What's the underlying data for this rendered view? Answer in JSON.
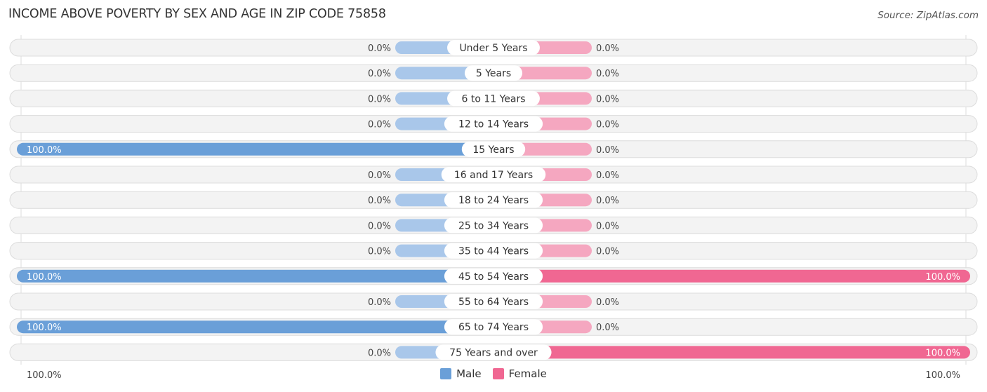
{
  "title": "INCOME ABOVE POVERTY BY SEX AND AGE IN ZIP CODE 75858",
  "source": "Source: ZipAtlas.com",
  "colors": {
    "male": "#6a9fd8",
    "male_light": "#a9c7ea",
    "female": "#f06792",
    "female_light": "#f5a7c0",
    "track": "#f3f3f3"
  },
  "legend": [
    {
      "label": "Male",
      "color": "#6a9fd8"
    },
    {
      "label": "Female",
      "color": "#f06792"
    }
  ],
  "axis": {
    "left_label": "100.0%",
    "right_label": "100.0%"
  },
  "chart_data": {
    "type": "bar",
    "orientation": "horizontal-butterfly",
    "title": "INCOME ABOVE POVERTY BY SEX AND AGE IN ZIP CODE 75858",
    "categories": [
      "Under 5 Years",
      "5 Years",
      "6 to 11 Years",
      "12 to 14 Years",
      "15 Years",
      "16 and 17 Years",
      "18 to 24 Years",
      "25 to 34 Years",
      "35 to 44 Years",
      "45 to 54 Years",
      "55 to 64 Years",
      "65 to 74 Years",
      "75 Years and over"
    ],
    "series": [
      {
        "name": "Male",
        "values": [
          0,
          0,
          0,
          0,
          100,
          0,
          0,
          0,
          0,
          100,
          0,
          100,
          0
        ],
        "labels": [
          "0.0%",
          "0.0%",
          "0.0%",
          "0.0%",
          "100.0%",
          "0.0%",
          "0.0%",
          "0.0%",
          "0.0%",
          "100.0%",
          "0.0%",
          "100.0%",
          "0.0%"
        ]
      },
      {
        "name": "Female",
        "values": [
          0,
          0,
          0,
          0,
          0,
          0,
          0,
          0,
          0,
          100,
          0,
          0,
          100
        ],
        "labels": [
          "0.0%",
          "0.0%",
          "0.0%",
          "0.0%",
          "0.0%",
          "0.0%",
          "0.0%",
          "0.0%",
          "0.0%",
          "100.0%",
          "0.0%",
          "0.0%",
          "100.0%"
        ]
      }
    ],
    "xlim": [
      0,
      100
    ],
    "xlabel": "",
    "ylabel": "",
    "legend_position": "bottom-center",
    "grid": false
  }
}
